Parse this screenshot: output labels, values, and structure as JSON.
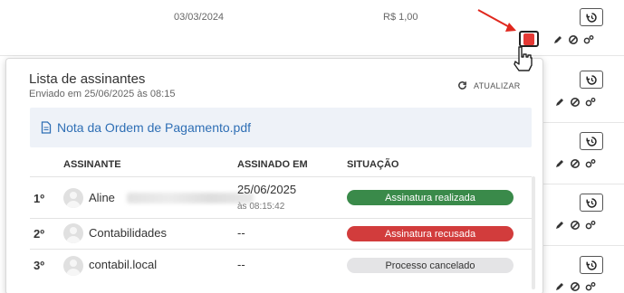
{
  "background_row": {
    "date": "03/03/2024",
    "value": "R$ 1,00"
  },
  "popover": {
    "title": "Lista de assinantes",
    "subtitle": "Enviado em 25/06/2025 às 08:15",
    "refresh_label": "ATUALIZAR",
    "file_name": "Nota da Ordem de Pagamento.pdf",
    "columns": {
      "signer": "ASSINANTE",
      "signed_at": "ASSINADO EM",
      "status": "SITUAÇÃO"
    },
    "rows": [
      {
        "index": "1º",
        "name": "Aline",
        "date": "25/06/2025",
        "time": "às 08:15:42",
        "status": "Assinatura realizada"
      },
      {
        "index": "2º",
        "name": "Contabilidades",
        "date": "--",
        "status": "Assinatura recusada"
      },
      {
        "index": "3º",
        "name": "contabil.local",
        "date": "--",
        "status": "Processo cancelado"
      }
    ]
  },
  "colors": {
    "status_ok": "#3a8a4a",
    "status_refused": "#d23c3c",
    "status_cancelled": "#e4e4e6",
    "link": "#2f6fb5",
    "pdf_icon": "#e53935"
  }
}
